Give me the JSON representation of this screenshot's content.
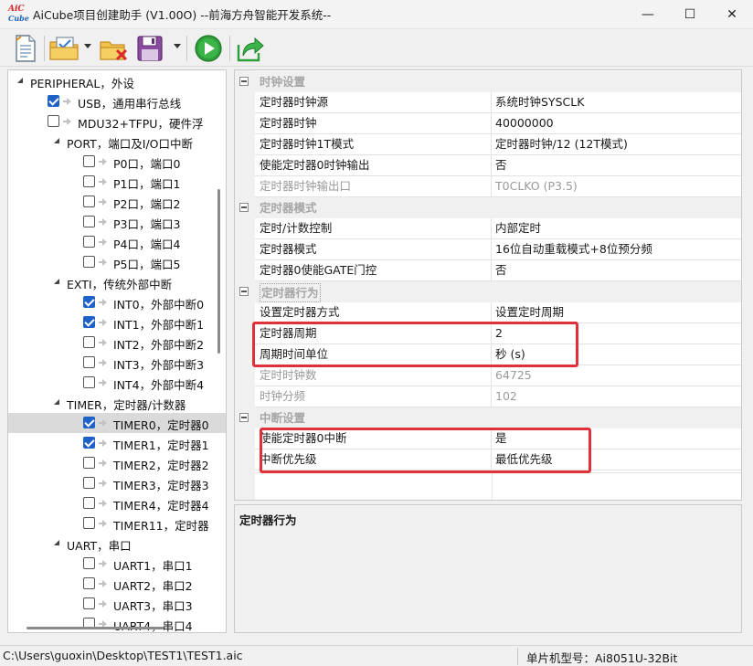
{
  "window": {
    "title": "AiCube项目创建助手 (V1.00O) --前海方舟智能开发系统--",
    "logo_top": "AiC",
    "logo_bottom": "Cube",
    "minimize": "—",
    "maximize": "☐",
    "close": "✕"
  },
  "toolbar": {
    "items": [
      "new-file-icon",
      "open-project-icon",
      "close-project-icon",
      "save-icon",
      "run-icon",
      "export-icon"
    ]
  },
  "tree": {
    "items": [
      {
        "label": "PERIPHERAL，外设",
        "checked": null,
        "expanded": true
      },
      {
        "label": "USB，通用串行总线",
        "checked": true
      },
      {
        "label": "MDU32+TFPU，硬件浮",
        "checked": false
      },
      {
        "label": "PORT，端口及I/O口中断",
        "checked": null,
        "expanded": true
      },
      {
        "label": "P0口，端口0",
        "checked": false
      },
      {
        "label": "P1口，端口1",
        "checked": false
      },
      {
        "label": "P2口，端口2",
        "checked": false
      },
      {
        "label": "P3口，端口3",
        "checked": false
      },
      {
        "label": "P4口，端口4",
        "checked": false
      },
      {
        "label": "P5口，端口5",
        "checked": false
      },
      {
        "label": "EXTI，传统外部中断",
        "checked": null,
        "expanded": true
      },
      {
        "label": "INT0，外部中断0",
        "checked": true
      },
      {
        "label": "INT1，外部中断1",
        "checked": true
      },
      {
        "label": "INT2，外部中断2",
        "checked": false
      },
      {
        "label": "INT3，外部中断3",
        "checked": false
      },
      {
        "label": "INT4，外部中断4",
        "checked": false
      },
      {
        "label": "TIMER，定时器/计数器",
        "checked": null,
        "expanded": true
      },
      {
        "label": "TIMER0，定时器0",
        "checked": true,
        "selected": true
      },
      {
        "label": "TIMER1，定时器1",
        "checked": true
      },
      {
        "label": "TIMER2，定时器2",
        "checked": false
      },
      {
        "label": "TIMER3，定时器3",
        "checked": false
      },
      {
        "label": "TIMER4，定时器4",
        "checked": false
      },
      {
        "label": "TIMER11，定时器",
        "checked": false
      },
      {
        "label": "UART，串口",
        "checked": null,
        "expanded": true
      },
      {
        "label": "UART1，串口1",
        "checked": false
      },
      {
        "label": "UART2，串口2",
        "checked": false
      },
      {
        "label": "UART3，串口3",
        "checked": false
      },
      {
        "label": "UART4，串口4",
        "checked": false
      }
    ]
  },
  "properties": {
    "cat_clock": "时钟设置",
    "clock_source_name": "定时器时钟源",
    "clock_source_value": "系统时钟SYSCLK",
    "clock_name": "定时器时钟",
    "clock_value": "40000000",
    "mode_1t_name": "定时器时钟1T模式",
    "mode_1t_value": "定时器时钟/12 (12T模式)",
    "clkout_en_name": "使能定时器0时钟输出",
    "clkout_en_value": "否",
    "clkout_pin_name": "定时器时钟输出口",
    "clkout_pin_value": "T0CLKO (P3.5)",
    "cat_mode": "定时器模式",
    "count_ctrl_name": "定时/计数控制",
    "count_ctrl_value": "内部定时",
    "timer_mode_name": "定时器模式",
    "timer_mode_value": "16位自动重载模式+8位预分频",
    "gate_name": "定时器0使能GATE门控",
    "gate_value": "否",
    "cat_behavior": "定时器行为",
    "set_method_name": "设置定时器方式",
    "set_method_value": "设置定时周期",
    "period_name": "定时器周期",
    "period_value": "2",
    "unit_name": "周期时间单位",
    "unit_value": "秒 (s)",
    "ticks_name": "定时时钟数",
    "ticks_value": "64725",
    "prescale_name": "时钟分频",
    "prescale_value": "102",
    "cat_interrupt": "中断设置",
    "int_en_name": "使能定时器0中断",
    "int_en_value": "是",
    "priority_name": "中断优先级",
    "priority_value": "最低优先级"
  },
  "description": {
    "title": "定时器行为"
  },
  "status": {
    "path": "C:\\Users\\guoxin\\Desktop\\TEST1\\TEST1.aic",
    "chip": "单片机型号：Ai8051U-32Bit"
  },
  "colors": {
    "highlight": "#e0313a",
    "checkbox_on": "#1f62c7",
    "run_green": "#2e9e3a"
  }
}
